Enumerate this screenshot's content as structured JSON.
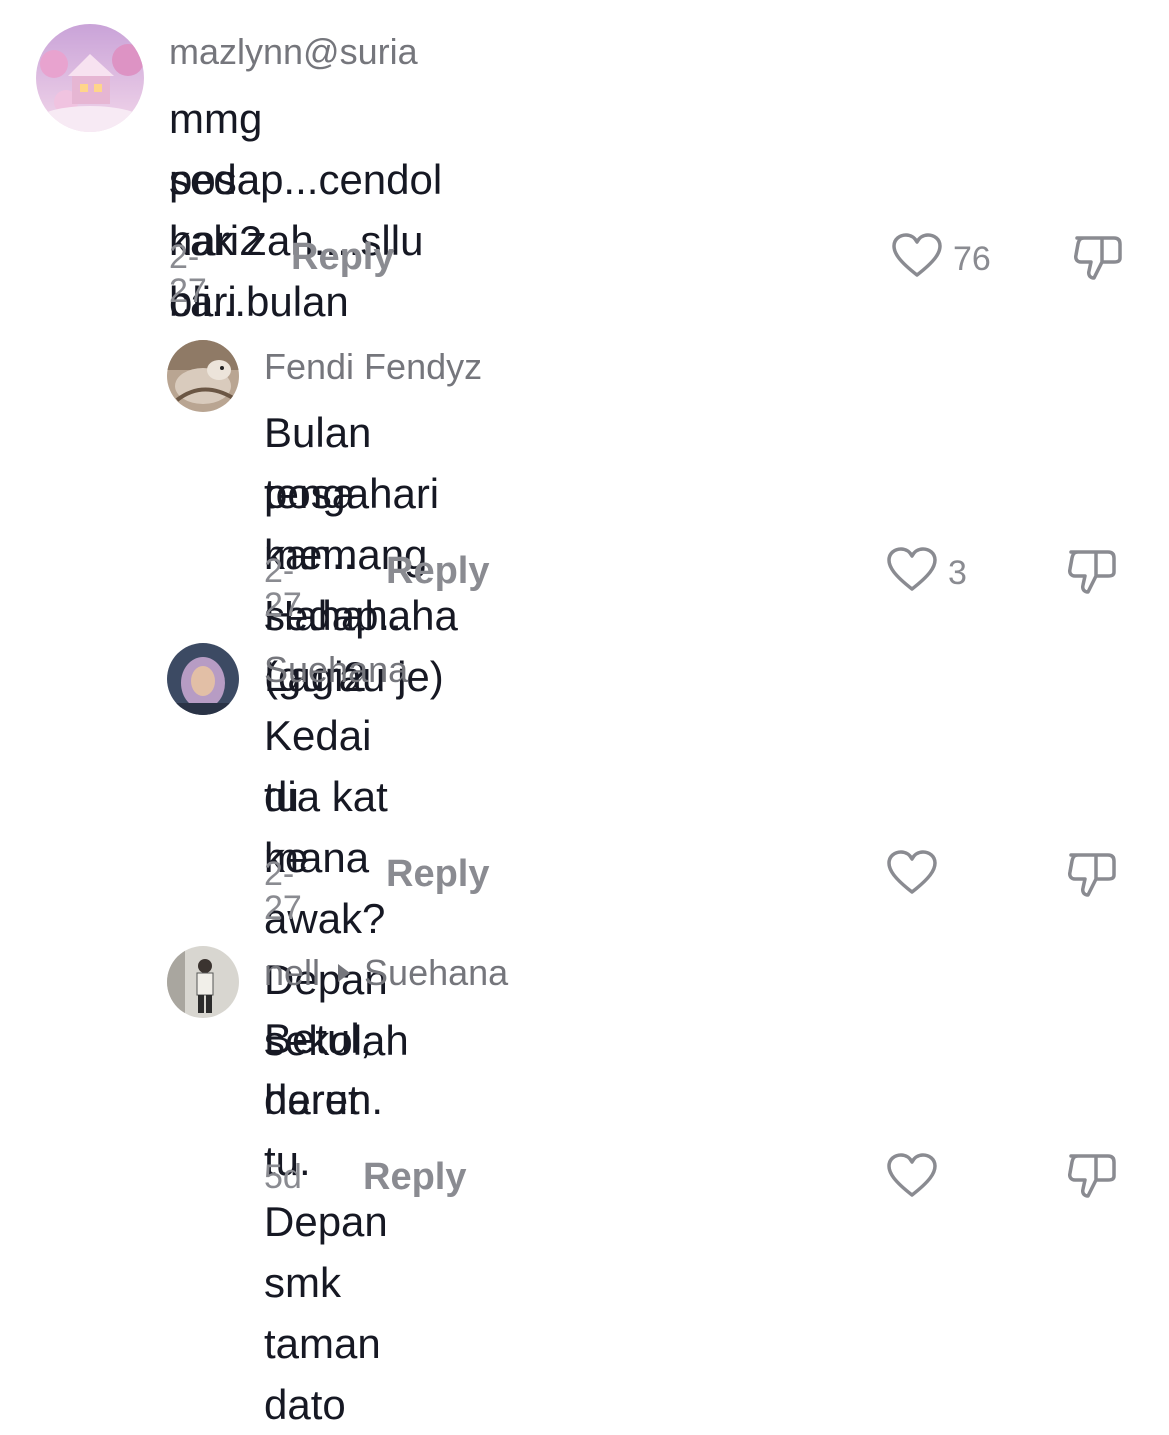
{
  "comments": [
    {
      "username": "mazlynn@suria",
      "text_line1": "mmg sedap...cendol kak zah....sllu bli...bulan",
      "text_line2": "posa hari2 cari",
      "date": "2-27",
      "reply_label": "Reply",
      "like_count": "76"
    },
    {
      "username": "Fendi Fendyz",
      "text_line1": "Bulan posa memang sedap.. Lagi2",
      "text_line2": "tengahari kan.. Hahahaha (gurau je)",
      "date": "2-27",
      "reply_label": "Reply",
      "like_count": "3"
    },
    {
      "username": "Suehana",
      "text_line1": "Kedai dia kat mana awak? Depan sekolah",
      "text_line2": "tu ke",
      "date": "2-27",
      "reply_label": "Reply",
      "like_count": ""
    },
    {
      "username": "nell",
      "reply_to": "Suehana",
      "text_line1": "Betul, deret tu. Depan smk taman dato",
      "text_line2": "harun.",
      "date": "5d",
      "reply_label": "Reply",
      "like_count": ""
    }
  ],
  "icons": {
    "like": "heart-outline-icon",
    "dislike": "thumbs-down-outline-icon"
  },
  "colors": {
    "text": "#161823",
    "muted": "#8a8b91"
  }
}
